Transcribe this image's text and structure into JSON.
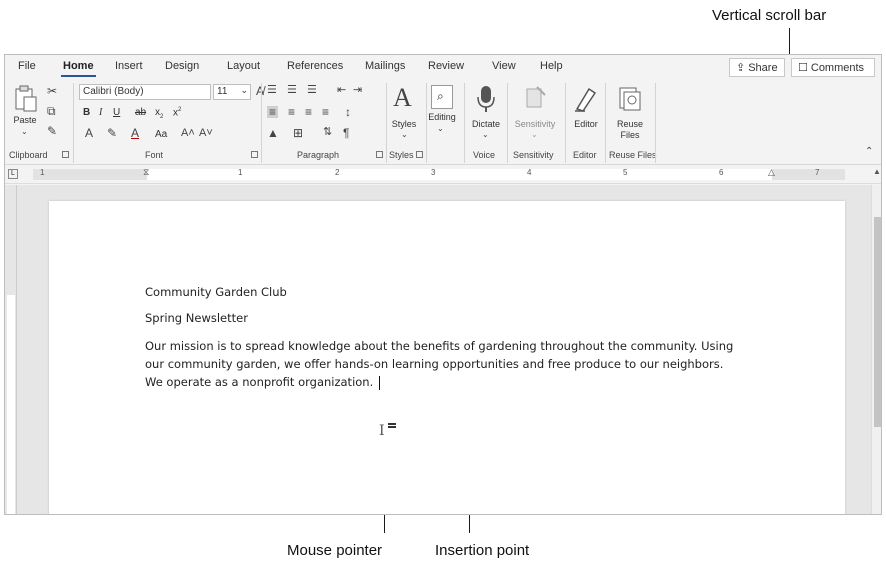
{
  "callouts": {
    "scroll_bar": "Vertical scroll bar",
    "mouse_pointer": "Mouse pointer",
    "insertion_point": "Insertion point"
  },
  "tabs": [
    "File",
    "Home",
    "Insert",
    "Design",
    "Layout",
    "References",
    "Mailings",
    "Review",
    "View",
    "Help"
  ],
  "top_buttons": {
    "share": "Share",
    "comments": "Comments"
  },
  "ribbon": {
    "clipboard": {
      "paste": "Paste",
      "group": "Clipboard"
    },
    "font": {
      "name": "Calibri (Body)",
      "size": "11",
      "group": "Font",
      "aa": "Aa"
    },
    "paragraph": {
      "group": "Paragraph"
    },
    "styles": {
      "label": "Styles",
      "group": "Styles"
    },
    "editing": {
      "label": "Editing"
    },
    "voice": {
      "label": "Dictate",
      "group": "Voice"
    },
    "sensitivity": {
      "label": "Sensitivity",
      "group": "Sensitivity"
    },
    "editor": {
      "label": "Editor",
      "group": "Editor"
    },
    "reuse": {
      "label1": "Reuse",
      "label2": "Files",
      "group": "Reuse Files"
    }
  },
  "ruler_numbers": [
    "1",
    "1",
    "2",
    "3",
    "4",
    "5",
    "6",
    "7"
  ],
  "document": {
    "title": "Community Garden Club",
    "subtitle": "Spring Newsletter",
    "body_lines": [
      "Our mission is to spread knowledge about the benefits of gardening throughout the community. Using",
      "our community garden, we offer hands-on learning opportunities and free produce to our neighbors.",
      "We operate as a nonprofit organization."
    ]
  },
  "colors": {
    "accent": "#2b579a",
    "ribbon_bg": "#f3f3f3",
    "doc_bg": "#e6e6e6"
  }
}
